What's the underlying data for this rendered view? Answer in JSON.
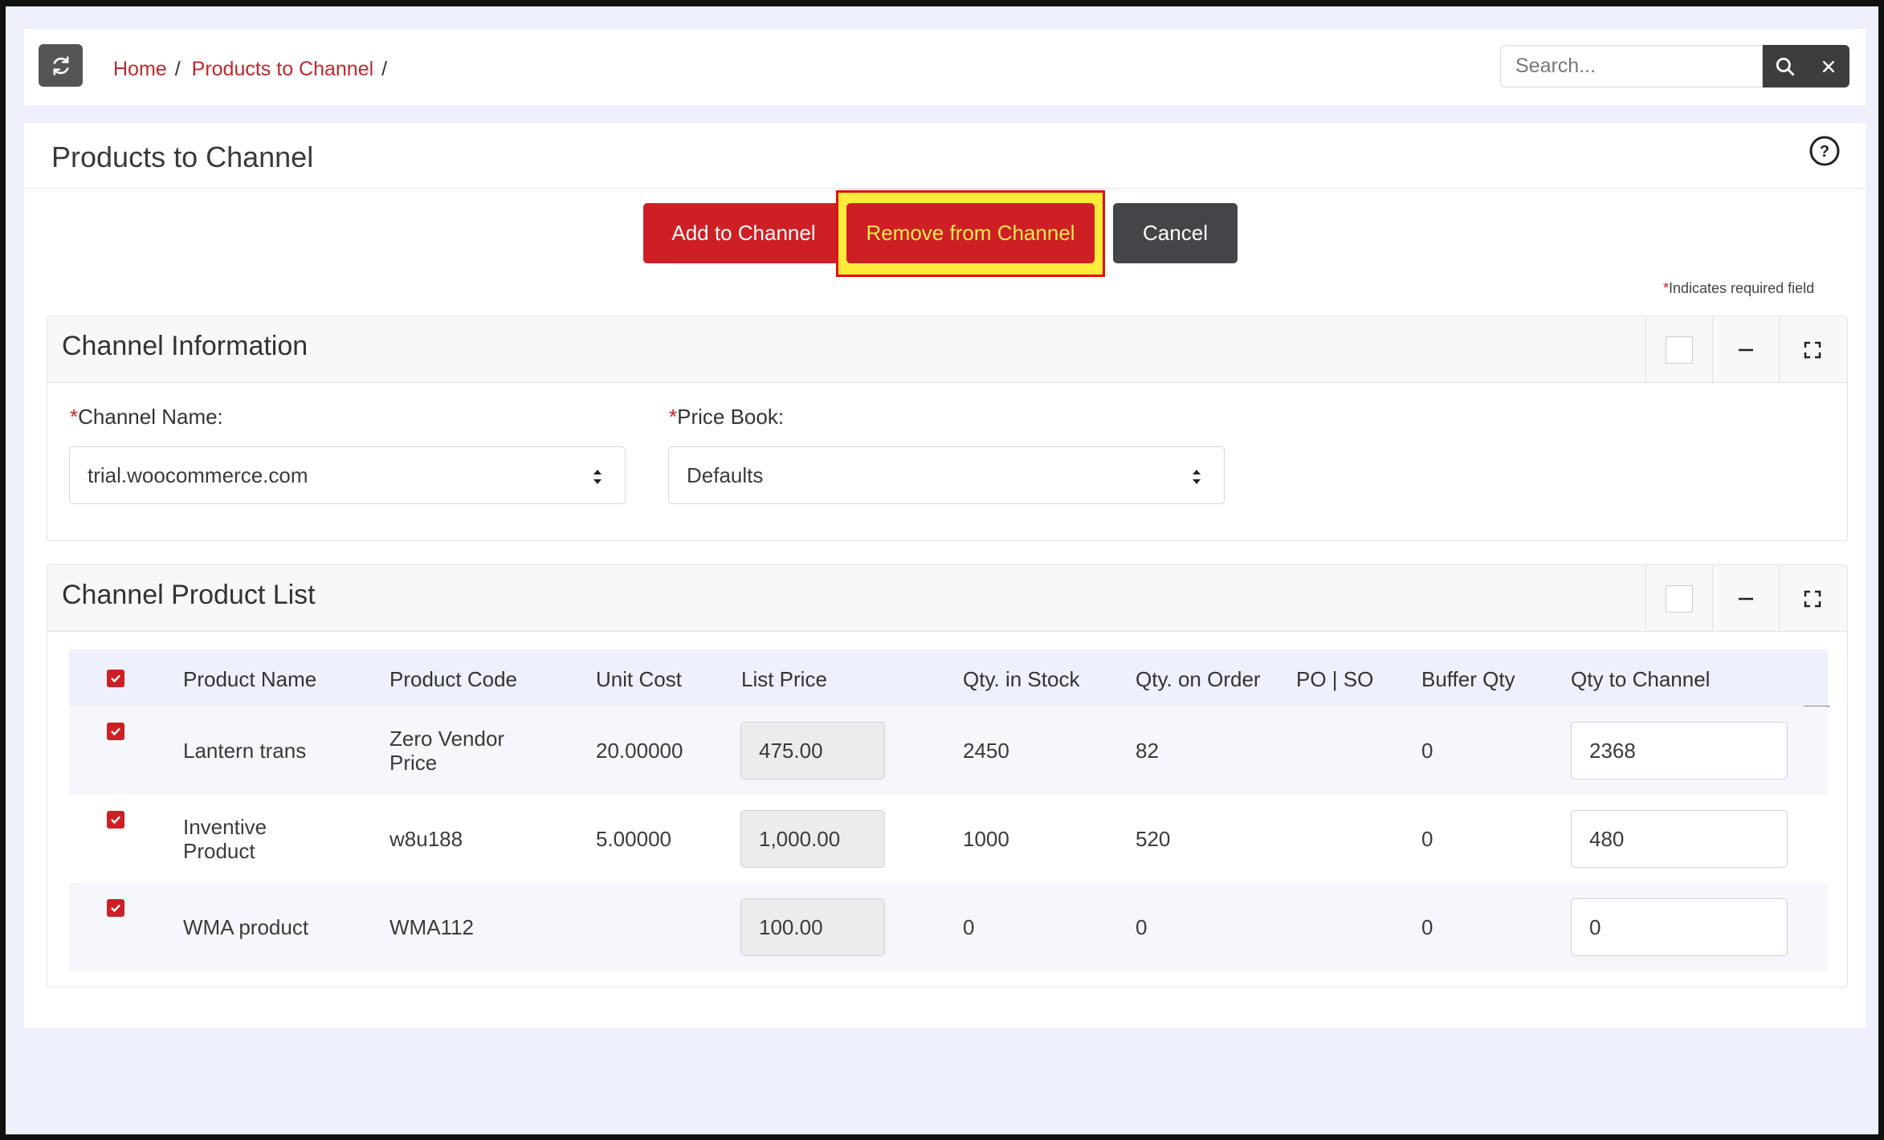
{
  "breadcrumb": {
    "home": "Home",
    "current": "Products to Channel",
    "separator": "/"
  },
  "search": {
    "placeholder": "Search...",
    "value": ""
  },
  "icons": {
    "refresh": "refresh-icon",
    "search": "search-icon",
    "clear": "close-icon",
    "help": "help-circle-icon",
    "minimize": "minimize-icon",
    "expand": "expand-icon",
    "checkbox": "checkbox-checked-icon"
  },
  "page": {
    "title": "Products to Channel"
  },
  "actions": {
    "add": "Add to Channel",
    "remove": "Remove from Channel",
    "cancel": "Cancel"
  },
  "required_note": {
    "star": "*",
    "text": "Indicates required field"
  },
  "channel_info": {
    "title": "Channel Information",
    "channel_name_label": "Channel Name:",
    "channel_name_value": "trial.woocommerce.com",
    "price_book_label": "Price Book:",
    "price_book_value": "Defaults"
  },
  "product_list": {
    "title": "Channel Product List",
    "columns": [
      "Product Name",
      "Product Code",
      "Unit Cost",
      "List Price",
      "Qty. in Stock",
      "Qty. on Order",
      "PO | SO",
      "Buffer Qty",
      "Qty to Channel"
    ],
    "rows": [
      {
        "name": "Lantern trans",
        "code": "Zero Vendor Price",
        "unit_cost": "20.00000",
        "list_price": "475.00",
        "qty_stock": "2450",
        "qty_order": "82",
        "po_so": "",
        "buffer": "0",
        "qty_channel": "2368",
        "checked": true
      },
      {
        "name": "Inventive Product",
        "code": "w8u188",
        "unit_cost": "5.00000",
        "list_price": "1,000.00",
        "qty_stock": "1000",
        "qty_order": "520",
        "po_so": "",
        "buffer": "0",
        "qty_channel": "480",
        "checked": true
      },
      {
        "name": "WMA product",
        "code": "WMA112",
        "unit_cost": "",
        "list_price": "100.00",
        "qty_stock": "0",
        "qty_order": "0",
        "po_so": "",
        "buffer": "0",
        "qty_channel": "0",
        "checked": true
      }
    ]
  },
  "colors": {
    "accent_red": "#cd1f24",
    "dark_button": "#444548",
    "highlight_yellow": "#ffeb3b",
    "page_bg": "#eef0fb"
  }
}
